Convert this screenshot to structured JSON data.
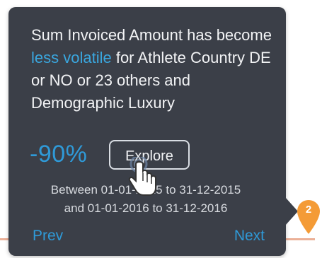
{
  "tooltip": {
    "message_part1": "Sum Invoiced Amount has become ",
    "message_highlight": "less volatile",
    "message_part2": " for Athlete Country DE or NO or 23 others and Demographic Luxury",
    "metric": "-90%",
    "explore_label": "Explore",
    "period_line1": "Between 01-01-2015 to 31-12-2015",
    "period_line2": "and 01-01-2016 to 31-12-2016",
    "prev_label": "Prev",
    "next_label": "Next"
  },
  "marker": {
    "number": "2"
  },
  "icons": {
    "cursor": "hand-pointer-icon",
    "marker": "map-pin-icon"
  },
  "colors": {
    "tooltip_bg": "#3b3f48",
    "accent_blue": "#2f9ad8",
    "marker_orange": "#f49b36",
    "text_light": "#f2f3f5"
  }
}
